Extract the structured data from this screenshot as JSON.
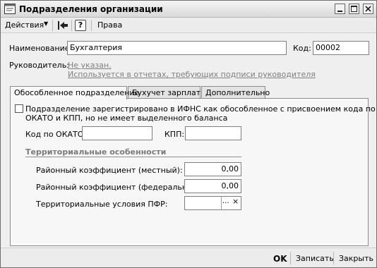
{
  "window": {
    "title": "Подразделения организации",
    "icon": "form-icon",
    "controls": [
      "minimize-icon",
      "maximize-icon",
      "close-icon"
    ]
  },
  "toolbar": {
    "actions_label": "Действия",
    "rights_label": "Права",
    "help_label": "?"
  },
  "form": {
    "name_label": "Наименование:",
    "name_value": "Бухгалтерия",
    "code_label": "Код:",
    "code_value": "00002",
    "manager_label": "Руководитель:",
    "manager_value": "Не указан.",
    "manager_hint": "Используется в отчетах, требующих подписи руководителя"
  },
  "tabs": [
    {
      "label": "Обособленное подразделение",
      "active": true
    },
    {
      "label": "Бухучет зарплаты",
      "active": false
    },
    {
      "label": "Дополнительно",
      "active": false
    }
  ],
  "tab_main": {
    "checkbox_checked": false,
    "checkbox_line1": "Подразделение зарегистрировано в ИФНС как обособленное с присвоением кода по",
    "checkbox_line2": "ОКАТО и КПП, но не имеет выделенного баланса",
    "okato_label": "Код по ОКАТО:",
    "okato_value": "",
    "kpp_label": "КПП:",
    "kpp_value": "",
    "section_title": "Территориальные особенности",
    "local_coef_label": "Районный коэффициент (местный):",
    "local_coef_value": "0,00",
    "federal_coef_label": "Районный коэффициент (федеральный):",
    "federal_coef_value": "0,00",
    "pfr_label": "Территориальные условия ПФР:",
    "pfr_value": "",
    "pfr_pick_label": "...",
    "pfr_clear_label": "×"
  },
  "footer": {
    "ok_label": "OK",
    "save_label": "Записать",
    "close_label": "Закрыть"
  }
}
